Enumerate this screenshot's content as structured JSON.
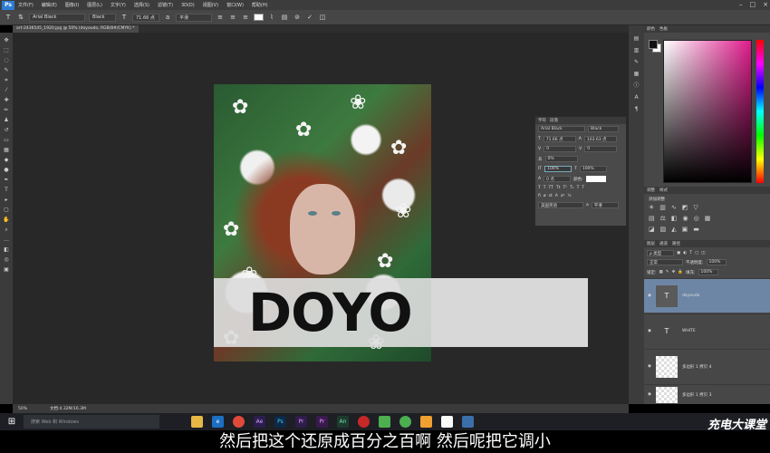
{
  "menubar": {
    "logo": "Ps",
    "items": [
      "文件(F)",
      "编辑(E)",
      "图像(I)",
      "图层(L)",
      "文字(Y)",
      "选择(S)",
      "滤镜(T)",
      "3D(D)",
      "视图(V)",
      "窗口(W)",
      "帮助(H)"
    ]
  },
  "options": {
    "font_family": "Arial Black",
    "font_style": "Black",
    "font_size": "71.66 点",
    "antialias": "平滑"
  },
  "document_tab": "art-2436545_1920.jpg @ 50% (doyoudo, RGB/8#/CMYK) *",
  "canvas": {
    "big_text": "DOYO"
  },
  "character_panel": {
    "tabs": [
      "字符",
      "段落"
    ],
    "font_family": "Arial Black",
    "font_style": "Black",
    "font_size": "71.66 点",
    "leading": "103.63 点",
    "kerning": "0",
    "tracking": "0",
    "scale_h": "0%",
    "vscale": "100%",
    "hscale": "100%",
    "baseline": "0 点",
    "color_label": "颜色:",
    "language": "美国英语",
    "aa": "平滑"
  },
  "right_panel": {
    "color_tabs": [
      "颜色",
      "色板"
    ],
    "adjust_tabs": [
      "调整",
      "样式"
    ],
    "adjust_title": "添加调整",
    "layers_tabs": [
      "图层",
      "通道",
      "路径"
    ],
    "filter_label": "ρ 类型",
    "blend_mode": "正常",
    "opacity_label": "不透明度:",
    "opacity_value": "100%",
    "lock_label": "锁定:",
    "fill_label": "填充:",
    "fill_value": "100%",
    "layers": [
      {
        "name": "doyoudo",
        "type": "text",
        "selected": true
      },
      {
        "name": "WHITE",
        "type": "text",
        "selected": false
      },
      {
        "name": "多边形 1 拷贝 4",
        "type": "shape",
        "selected": false
      },
      {
        "name": "多边形 1 拷贝 3",
        "type": "shape",
        "selected": false
      }
    ]
  },
  "status": {
    "zoom": "50%",
    "doc_size": "文档:4.32M/16.3M"
  },
  "taskbar": {
    "search_placeholder": "搜索 Web 和 Windows"
  },
  "watermark": "充电大课堂",
  "subtitle": "然后把这个还原成百分之百啊 然后呢把它调小"
}
